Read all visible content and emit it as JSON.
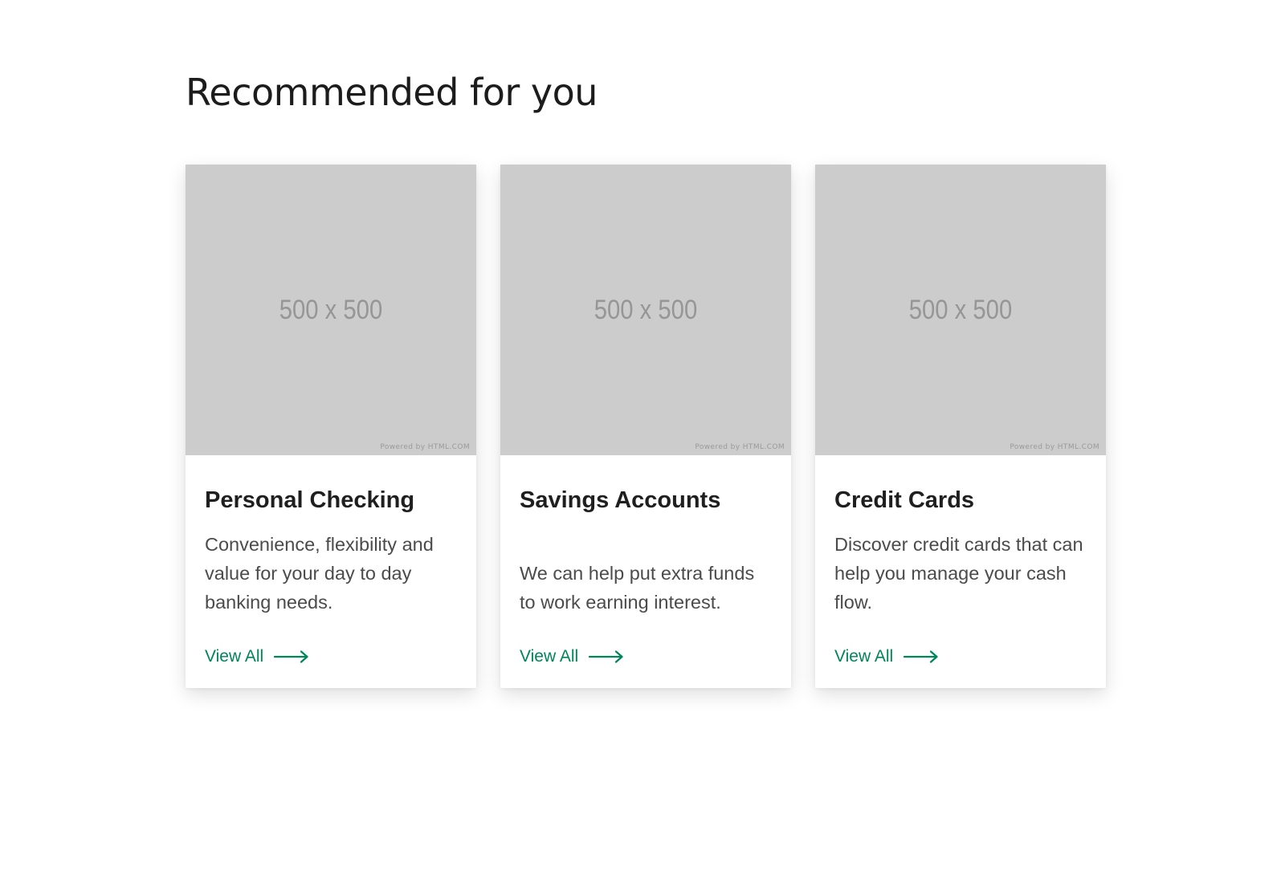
{
  "section": {
    "heading": "Recommended for you"
  },
  "cards": [
    {
      "title": "Personal Checking",
      "description": "Convenience, flexibility and value for your day to day banking needs.",
      "image_label": "500 x 500",
      "image_credit": "Powered by HTML.COM",
      "link_label": "View All"
    },
    {
      "title": "Savings Accounts",
      "description": "We can help put extra funds to work earning interest.",
      "image_label": "500 x 500",
      "image_credit": "Powered by HTML.COM",
      "link_label": "View All"
    },
    {
      "title": "Credit Cards",
      "description": "Discover credit cards that can help you manage your cash flow.",
      "image_label": "500 x 500",
      "image_credit": "Powered by HTML.COM",
      "link_label": "View All"
    }
  ],
  "colors": {
    "accent": "#00845a",
    "placeholder_bg": "#cccccc",
    "heading_text": "#1c1c1c",
    "body_text": "#4b4b4b"
  },
  "icons": {
    "link_icon": "arrow-right-icon"
  }
}
